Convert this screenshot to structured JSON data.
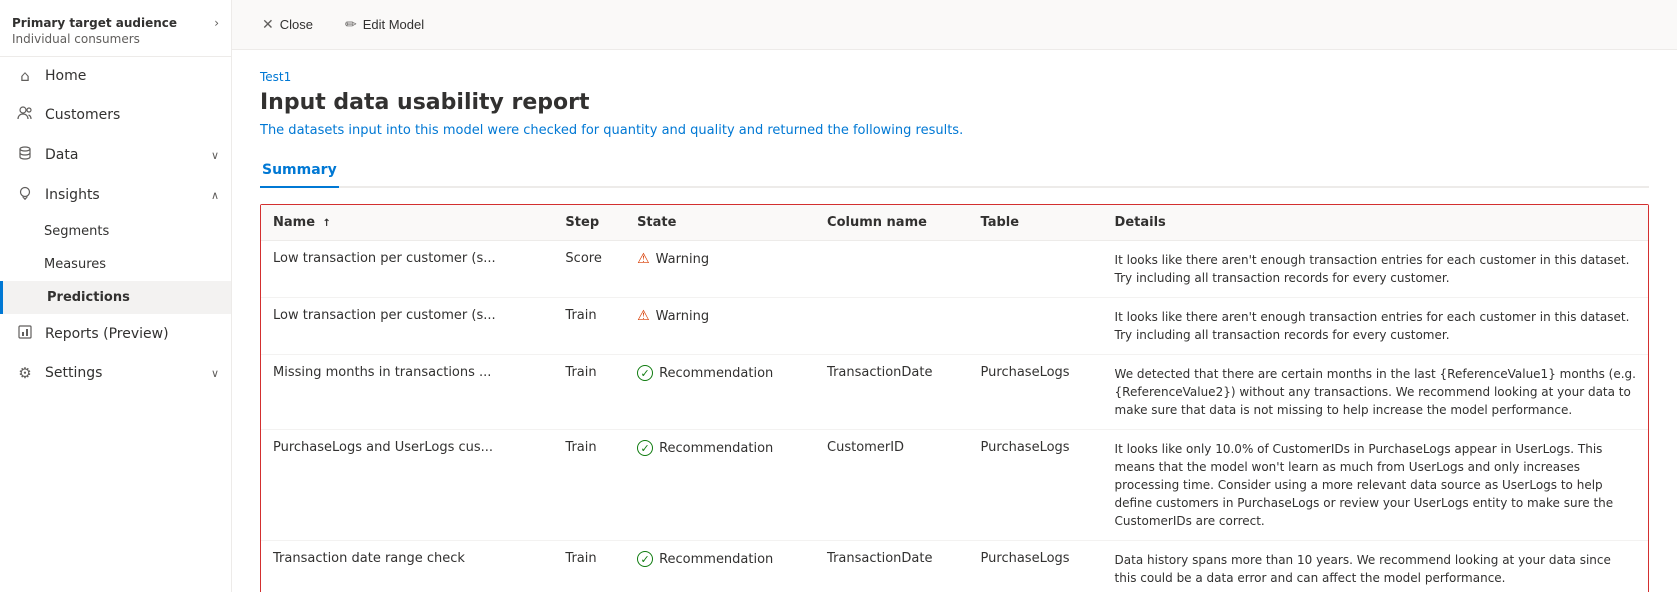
{
  "sidebar": {
    "primary_label": "Primary target audience",
    "secondary_label": "Individual consumers",
    "hamburger_icon": "☰",
    "chevron_icon": "›",
    "nav_items": [
      {
        "id": "home",
        "label": "Home",
        "icon": "⌂",
        "has_chevron": false,
        "active": false
      },
      {
        "id": "customers",
        "label": "Customers",
        "icon": "👤",
        "has_chevron": false,
        "active": false
      },
      {
        "id": "data",
        "label": "Data",
        "icon": "🗄",
        "has_chevron": true,
        "active": false
      },
      {
        "id": "insights",
        "label": "Insights",
        "icon": "💡",
        "has_chevron": true,
        "active": false,
        "expanded": true
      },
      {
        "id": "segments",
        "label": "Segments",
        "icon": "",
        "has_chevron": false,
        "active": false,
        "sub": true
      },
      {
        "id": "measures",
        "label": "Measures",
        "icon": "",
        "has_chevron": false,
        "active": false,
        "sub": true
      },
      {
        "id": "predictions",
        "label": "Predictions",
        "icon": "",
        "has_chevron": false,
        "active": true,
        "sub": true
      },
      {
        "id": "reports",
        "label": "Reports (Preview)",
        "icon": "📊",
        "has_chevron": false,
        "active": false
      },
      {
        "id": "settings",
        "label": "Settings",
        "icon": "⚙",
        "has_chevron": true,
        "active": false
      }
    ]
  },
  "topbar": {
    "close_label": "Close",
    "close_icon": "✕",
    "edit_label": "Edit Model",
    "edit_icon": "✏"
  },
  "content": {
    "breadcrumb": "Test1",
    "title": "Input data usability report",
    "description": "The datasets input into this model were checked for quantity and quality and returned the following results.",
    "tab_label": "Summary",
    "table": {
      "columns": [
        {
          "key": "name",
          "label": "Name",
          "sort": "↑"
        },
        {
          "key": "step",
          "label": "Step",
          "sort": ""
        },
        {
          "key": "state",
          "label": "State",
          "sort": ""
        },
        {
          "key": "column_name",
          "label": "Column name",
          "sort": ""
        },
        {
          "key": "table",
          "label": "Table",
          "sort": ""
        },
        {
          "key": "details",
          "label": "Details",
          "sort": ""
        }
      ],
      "rows": [
        {
          "name": "Low transaction per customer (s...",
          "step": "Score",
          "state_type": "warning",
          "state_label": "Warning",
          "column_name": "",
          "table": "",
          "details": "It looks like there aren't enough transaction entries for each customer in this dataset. Try including all transaction records for every customer."
        },
        {
          "name": "Low transaction per customer (s...",
          "step": "Train",
          "state_type": "warning",
          "state_label": "Warning",
          "column_name": "",
          "table": "",
          "details": "It looks like there aren't enough transaction entries for each customer in this dataset. Try including all transaction records for every customer."
        },
        {
          "name": "Missing months in transactions ...",
          "step": "Train",
          "state_type": "recommendation",
          "state_label": "Recommendation",
          "column_name": "TransactionDate",
          "table": "PurchaseLogs",
          "details": "We detected that there are certain months in the last {ReferenceValue1} months (e.g. {ReferenceValue2}) without any transactions. We recommend looking at your data to make sure that data is not missing to help increase the model performance."
        },
        {
          "name": "PurchaseLogs and UserLogs cus...",
          "step": "Train",
          "state_type": "recommendation",
          "state_label": "Recommendation",
          "column_name": "CustomerID",
          "table": "PurchaseLogs",
          "details": "It looks like only 10.0% of CustomerIDs in PurchaseLogs appear in UserLogs. This means that the model won't learn as much from UserLogs and only increases processing time. Consider using a more relevant data source as UserLogs to help define customers in PurchaseLogs or review your UserLogs entity to make sure the CustomerIDs are correct."
        },
        {
          "name": "Transaction date range check",
          "step": "Train",
          "state_type": "recommendation",
          "state_label": "Recommendation",
          "column_name": "TransactionDate",
          "table": "PurchaseLogs",
          "details": "Data history spans more than 10 years. We recommend looking at your data since this could be a data error and can affect the model performance."
        }
      ]
    }
  }
}
